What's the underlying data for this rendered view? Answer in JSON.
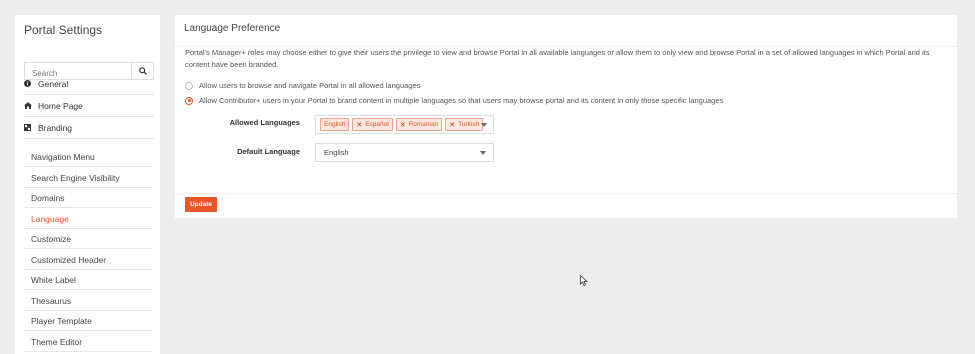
{
  "sidebar": {
    "title": "Portal Settings",
    "search": {
      "placeholder": "Search",
      "icon": "search-icon"
    },
    "items": [
      {
        "label": "General",
        "icon": "info-circle-icon"
      },
      {
        "label": "Home Page",
        "icon": "home-icon"
      },
      {
        "label": "Branding",
        "icon": "branding-icon"
      }
    ],
    "sub_items": [
      {
        "label": "Navigation Menu"
      },
      {
        "label": "Search Engine Visibility"
      },
      {
        "label": "Domains"
      },
      {
        "label": "Language",
        "active": true
      },
      {
        "label": "Customize"
      },
      {
        "label": "Customized Header"
      },
      {
        "label": "White Label"
      },
      {
        "label": "Thesaurus"
      },
      {
        "label": "Player Template"
      },
      {
        "label": "Theme Editor"
      }
    ]
  },
  "panel": {
    "title": "Language Preference",
    "description": "Portal's Manager+ roles may choose either to give their users the privilege to view and browse Portal in all available languages or allow them to only view and browse Portal in a set of allowed languages in which Portal and its content have been branded.",
    "options": [
      {
        "label": "Allow users to browse and navigate Portal in all allowed languages",
        "selected": false
      },
      {
        "label": "Allow Contributor+ users in your Portal to brand content in multiple languages so that users may browse portal and its content in only those specific languages",
        "selected": true
      }
    ],
    "allowed_languages": {
      "label": "Allowed Languages",
      "chips": [
        "English",
        "Español",
        "Romanian",
        "Turkish"
      ]
    },
    "default_language": {
      "label": "Default Language",
      "value": "English"
    },
    "update_label": "Update"
  },
  "colors": {
    "accent": "#e8572a",
    "chip_bg": "#fde7df",
    "page_bg": "#ededed"
  }
}
